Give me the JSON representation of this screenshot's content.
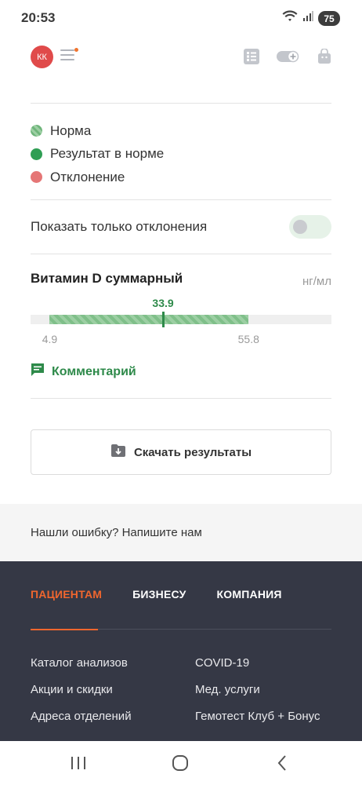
{
  "status_bar": {
    "time": "20:53",
    "battery": "75",
    "icons": [
      "wifi-icon",
      "signal-icon"
    ]
  },
  "header": {
    "avatar_initials": "КК",
    "icons": [
      "menu-icon",
      "list-icon",
      "toggle-add-icon",
      "bag-icon"
    ]
  },
  "legend": [
    {
      "label": "Норма",
      "kind": "norm"
    },
    {
      "label": "Результат в норме",
      "kind": "ok"
    },
    {
      "label": "Отклонение",
      "kind": "deviation"
    }
  ],
  "filter": {
    "label": "Показать только отклонения",
    "enabled": false
  },
  "test": {
    "title": "Витамин D суммарный",
    "unit": "нг/мл",
    "value": 33.9,
    "value_label": "33.9",
    "ref_min": 4.9,
    "ref_min_label": "4.9",
    "ref_max": 55.8,
    "ref_max_label": "55.8",
    "scale_min": 0,
    "scale_max": 77
  },
  "comment": {
    "label": "Комментарий"
  },
  "download": {
    "label": "Скачать результаты"
  },
  "feedback": {
    "text": "Нашли ошибку? Напишите нам"
  },
  "footer": {
    "tabs": [
      {
        "label": "ПАЦИЕНТАМ",
        "active": true
      },
      {
        "label": "БИЗНЕСУ",
        "active": false
      },
      {
        "label": "КОМПАНИЯ",
        "active": false
      }
    ],
    "links": [
      "Каталог анализов",
      "COVID-19",
      "Акции и скидки",
      "Мед. услуги",
      "Адреса отделений",
      "Гемотест Клуб + Бонус"
    ]
  },
  "colors": {
    "accent_green": "#2e8a4a",
    "accent_orange": "#f0662e",
    "deviation_red": "#e57676",
    "footer_bg": "#353845"
  }
}
